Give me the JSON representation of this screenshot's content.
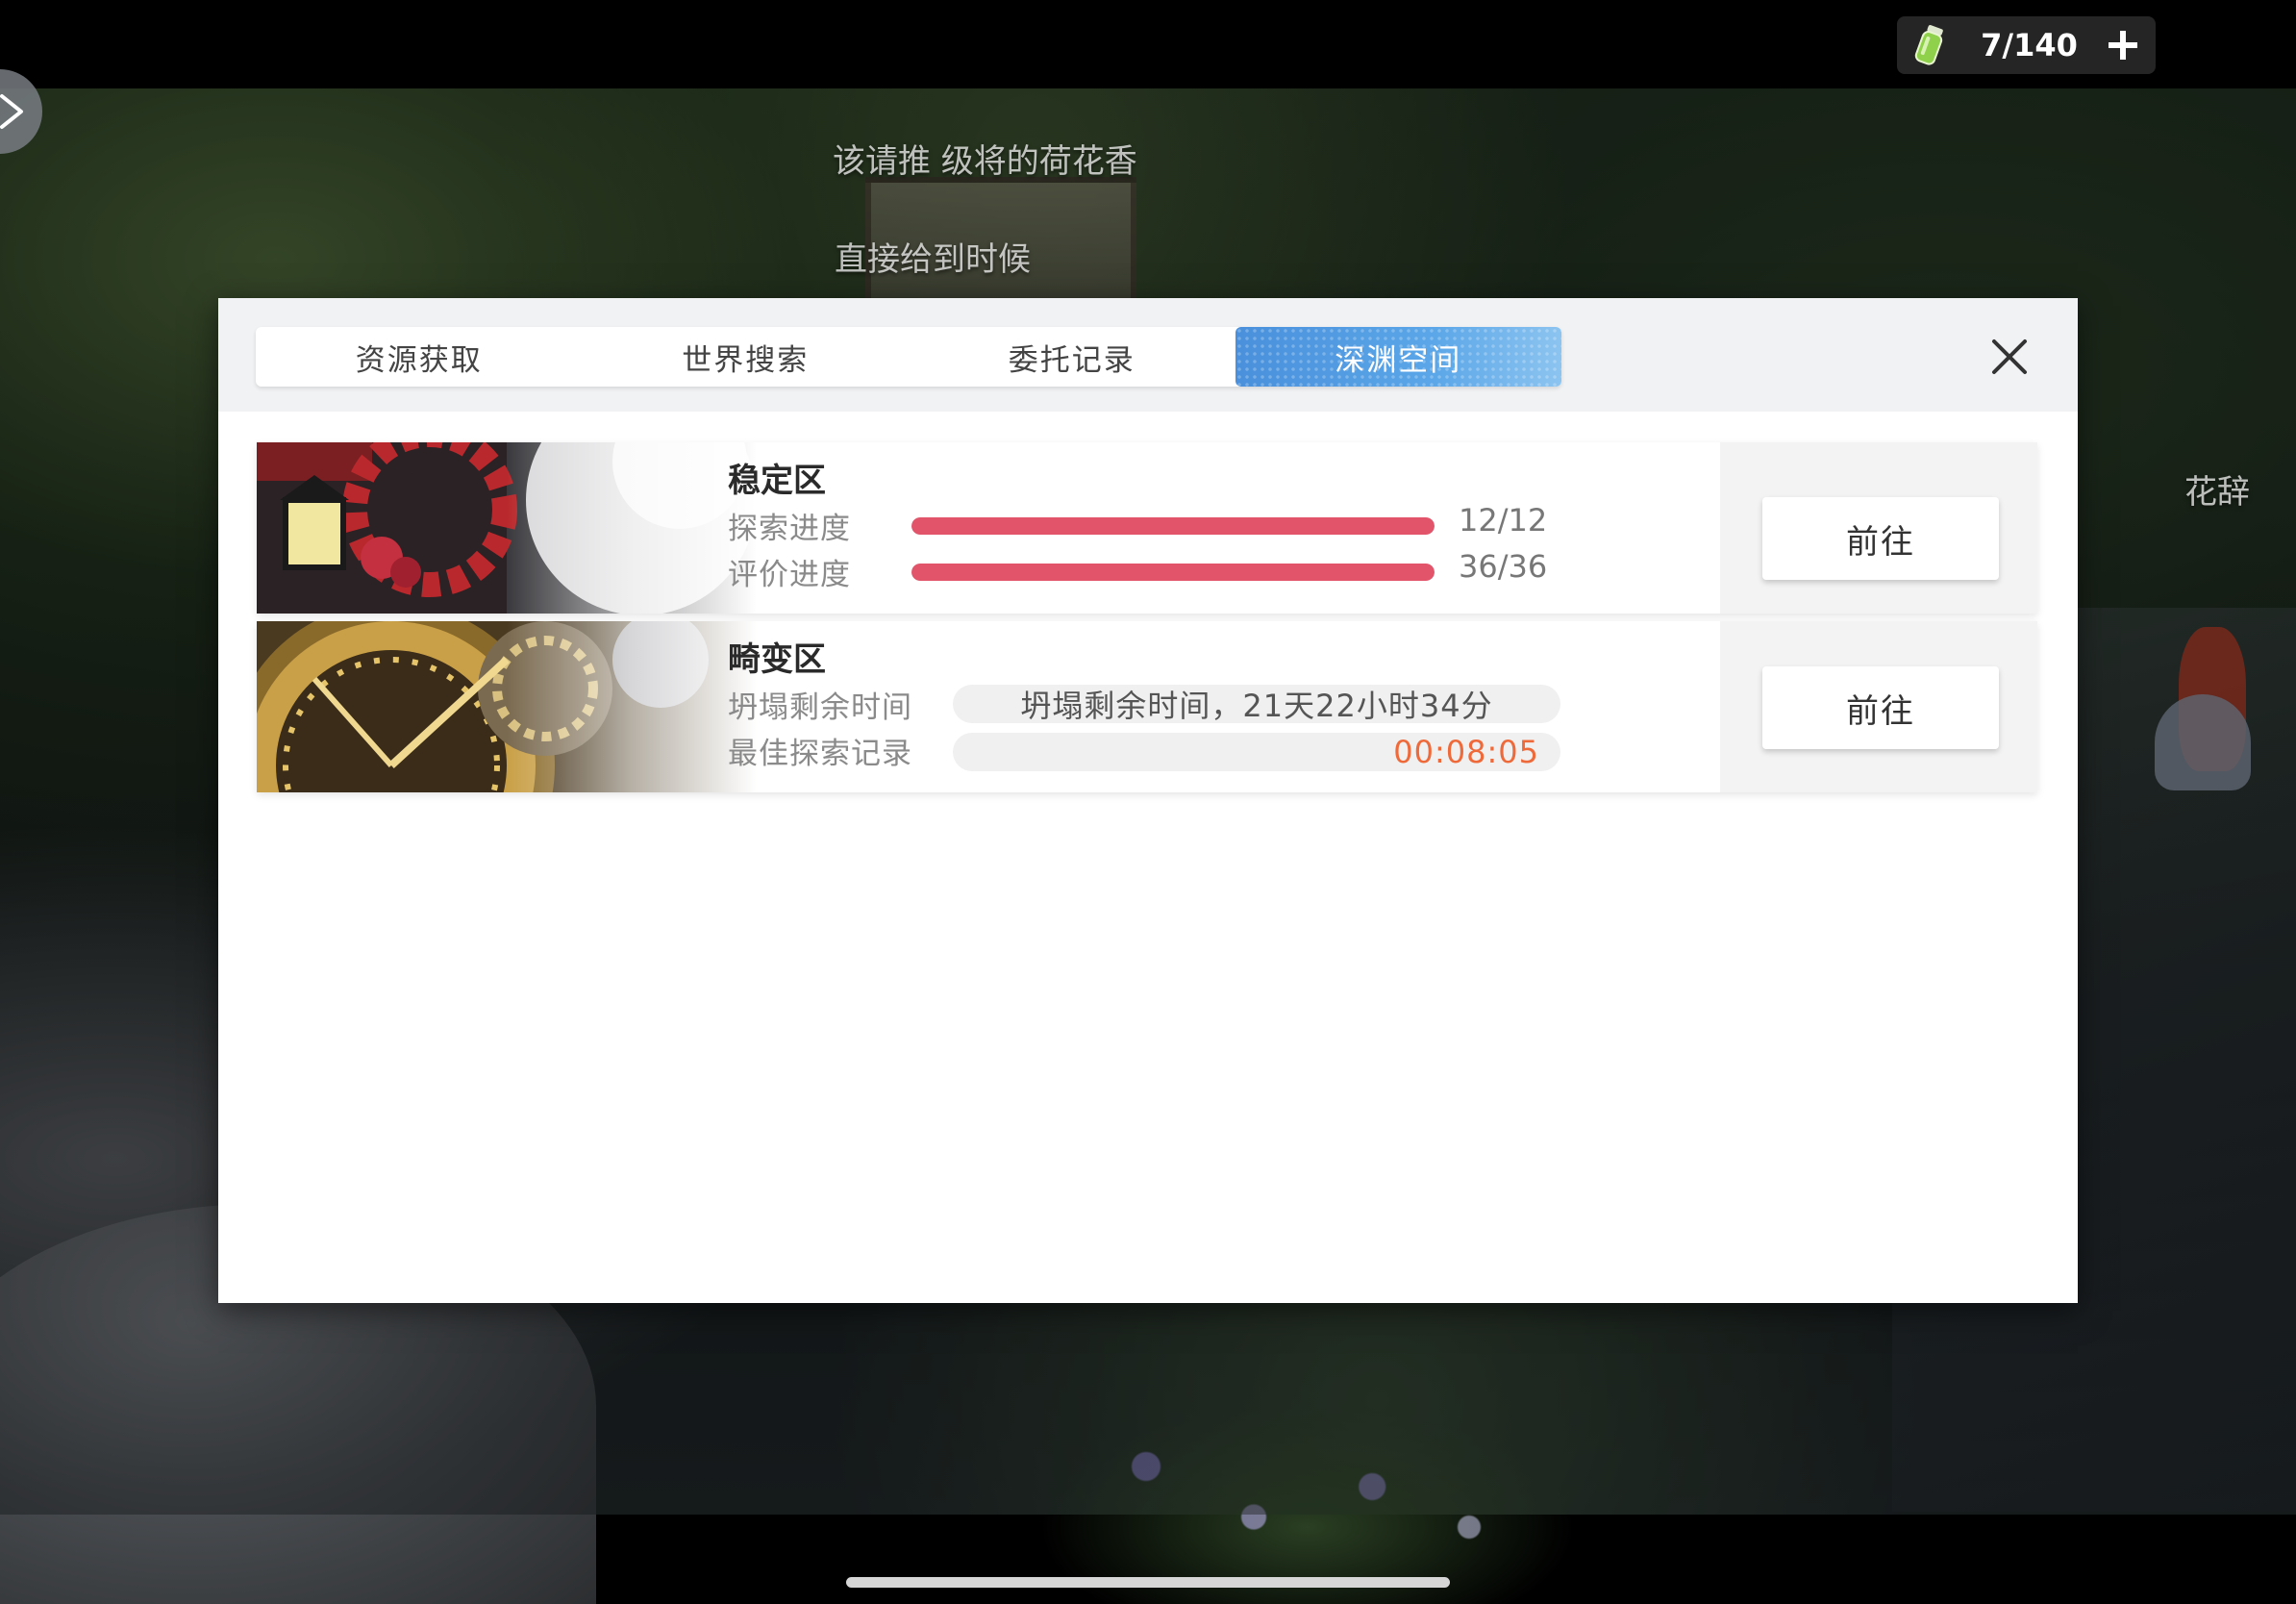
{
  "stamina": {
    "count": "7/140",
    "icon": "green-vial-icon",
    "add_icon": "plus-icon"
  },
  "scene": {
    "overlay_line_1": "该请推 级将的荷花香",
    "overlay_line_2": "直接给到时候",
    "character_name": "花辞"
  },
  "tabs": [
    {
      "label": "资源获取",
      "active": false
    },
    {
      "label": "世界搜索",
      "active": false
    },
    {
      "label": "委托记录",
      "active": false
    },
    {
      "label": "深渊空间",
      "active": true
    }
  ],
  "close_icon": "close-icon",
  "zones": [
    {
      "title": "稳定区",
      "rows": [
        {
          "label": "探索进度",
          "value": "12/12",
          "progress": 1.0
        },
        {
          "label": "评价进度",
          "value": "36/36",
          "progress": 1.0
        }
      ],
      "go_label": "前往"
    },
    {
      "title": "畸变区",
      "rows": [
        {
          "label": "坍塌剩余时间",
          "value": "坍塌剩余时间，21天22小时34分"
        },
        {
          "label": "最佳探索记录",
          "value": "00:08:05"
        }
      ],
      "go_label": "前往"
    }
  ],
  "colors": {
    "accent_tab": "#4a90dc",
    "progress_fill": "#e2546a",
    "record_time": "#ef6a3a"
  }
}
